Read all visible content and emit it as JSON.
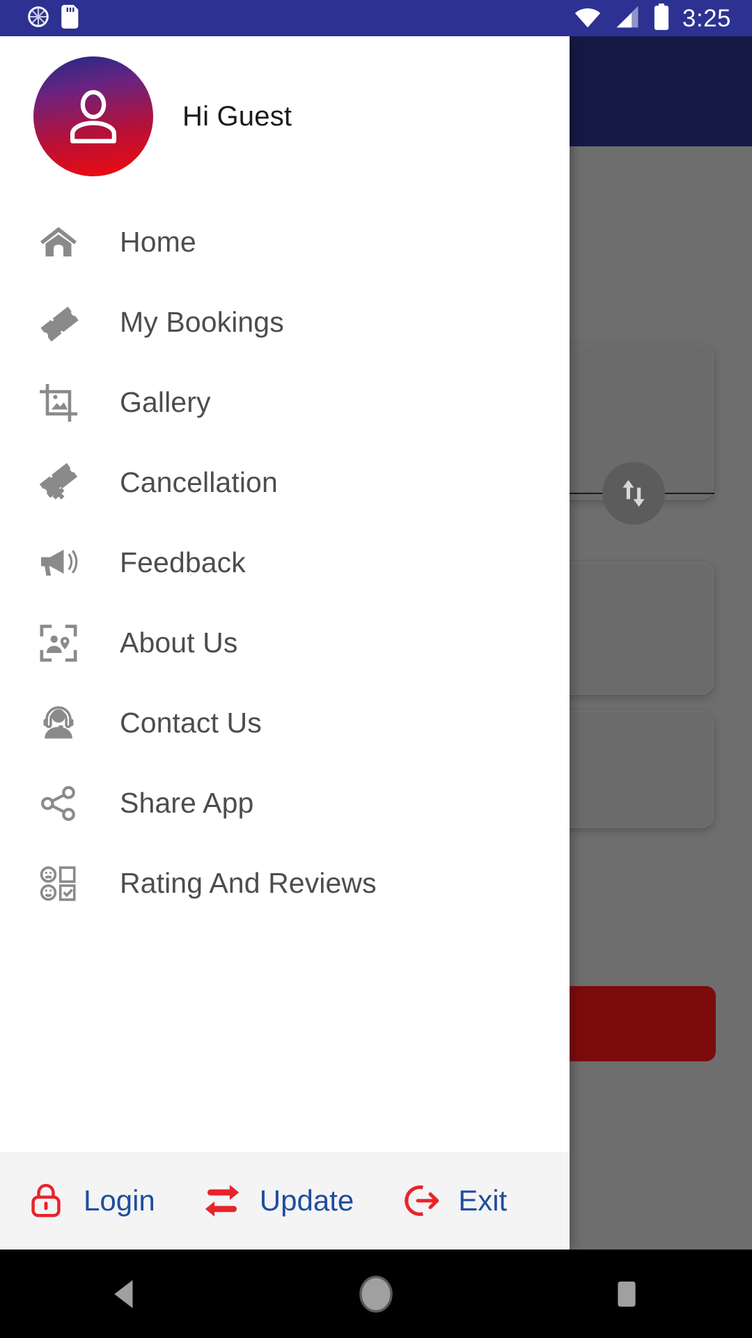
{
  "status_bar": {
    "time": "3:25",
    "icons": [
      "sync-icon",
      "sd-card-icon",
      "wifi-icon",
      "cellular-signal-icon",
      "battery-icon"
    ],
    "background_color": "#2d3192"
  },
  "drawer": {
    "profile": {
      "greeting": "Hi Guest",
      "avatar_icon": "person-avatar-icon",
      "avatar_gradient_from": "#202b86",
      "avatar_gradient_to": "#f40a0a"
    },
    "menu_items": [
      {
        "label": "Home",
        "icon": "home-icon"
      },
      {
        "label": "My Bookings",
        "icon": "ticket-icon"
      },
      {
        "label": "Gallery",
        "icon": "image-crop-icon"
      },
      {
        "label": "Cancellation",
        "icon": "ticket-cancel-icon"
      },
      {
        "label": "Feedback",
        "icon": "megaphone-icon"
      },
      {
        "label": "About Us",
        "icon": "person-location-frame-icon"
      },
      {
        "label": "Contact Us",
        "icon": "headset-support-icon"
      },
      {
        "label": "Share App",
        "icon": "share-nodes-icon"
      },
      {
        "label": "Rating And Reviews",
        "icon": "rating-checkbox-icon"
      }
    ],
    "footer_actions": [
      {
        "label": "Login",
        "icon": "lock-icon"
      },
      {
        "label": "Update",
        "icon": "swap-arrows-icon"
      },
      {
        "label": "Exit",
        "icon": "logout-icon"
      }
    ],
    "menu_text_color": "#4d4d4d",
    "footer_text_color": "#1f4d9e",
    "footer_icon_color": "#e8242a",
    "footer_background": "#f4f4f5"
  },
  "background_app": {
    "appbar_color": "#141a45",
    "scrim_color": "#6e6e6e",
    "primary_button_color": "#7c0c0c",
    "swap_icon": "swap-vertical-icon"
  },
  "nav_bar": {
    "back": "back-triangle-icon",
    "home": "home-circle-icon",
    "recents": "recents-square-icon"
  }
}
